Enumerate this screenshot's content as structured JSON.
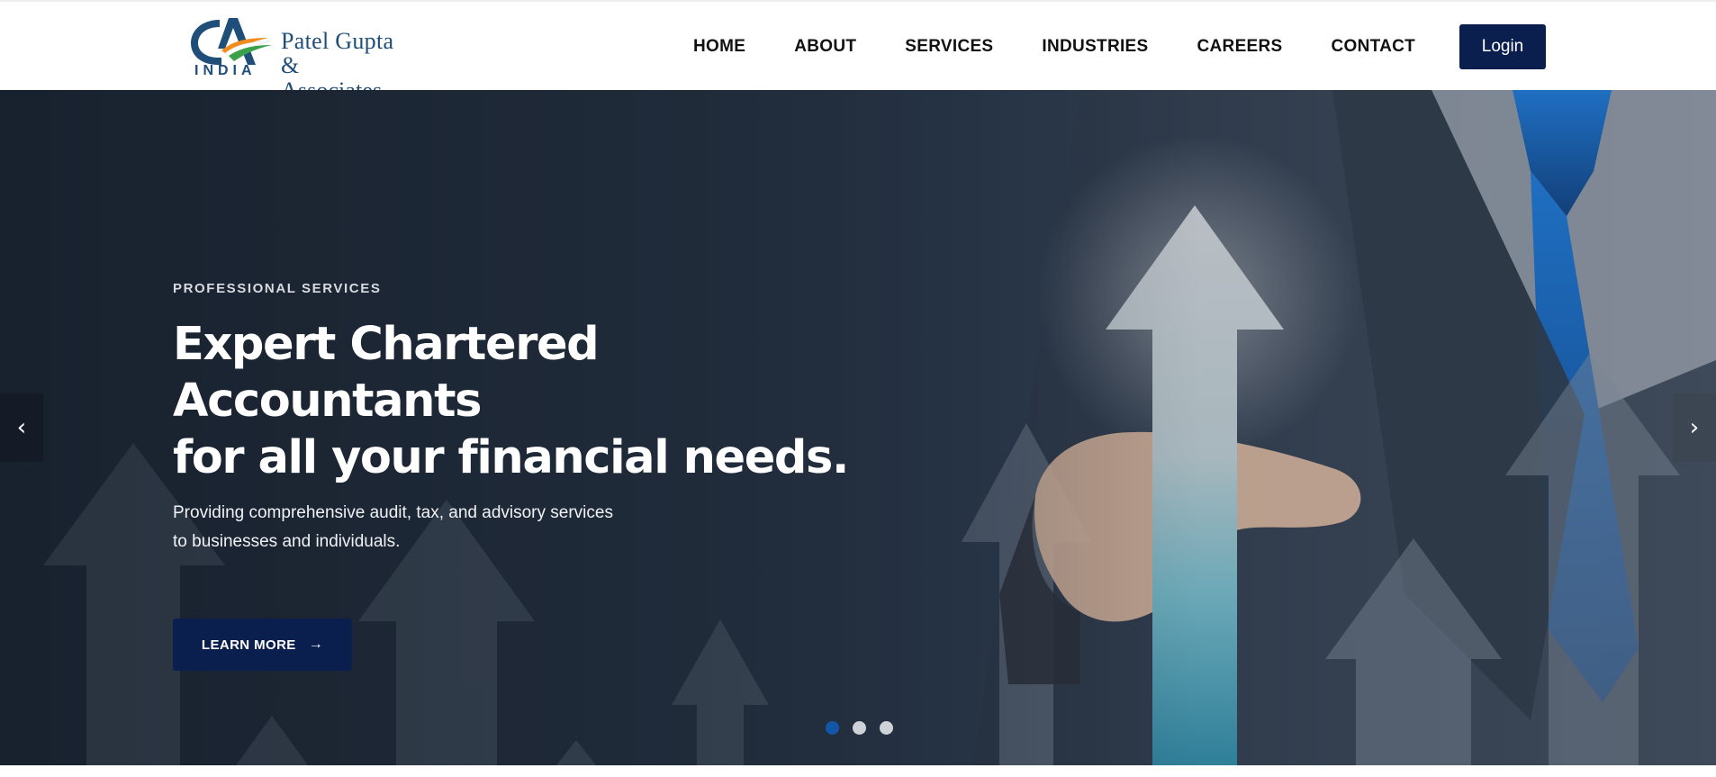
{
  "brand": {
    "logo_mark": "CA",
    "logo_country": "INDIA",
    "name_line1": "Patel  Gupta",
    "name_line2": "& Associates",
    "color_primary": "#0b1f4e",
    "color_logo": "#1f4e79"
  },
  "nav": {
    "items": [
      {
        "label": "HOME"
      },
      {
        "label": "ABOUT"
      },
      {
        "label": "SERVICES"
      },
      {
        "label": "INDUSTRIES"
      },
      {
        "label": "CAREERS"
      },
      {
        "label": "CONTACT"
      }
    ],
    "login_label": "Login"
  },
  "hero": {
    "eyebrow": "PROFESSIONAL SERVICES",
    "headline_line1": "Expert Chartered Accountants",
    "headline_line2": "for all your financial needs.",
    "subtext_line1": "Providing comprehensive audit, tax, and advisory services",
    "subtext_line2": "to businesses and individuals.",
    "cta_label": "LEARN MORE",
    "cta_icon": "arrow-right-icon",
    "prev_icon": "chevron-left-icon",
    "next_icon": "chevron-right-icon",
    "slides_total": 3,
    "active_slide": 1,
    "dot_active_color": "#1356a8"
  }
}
